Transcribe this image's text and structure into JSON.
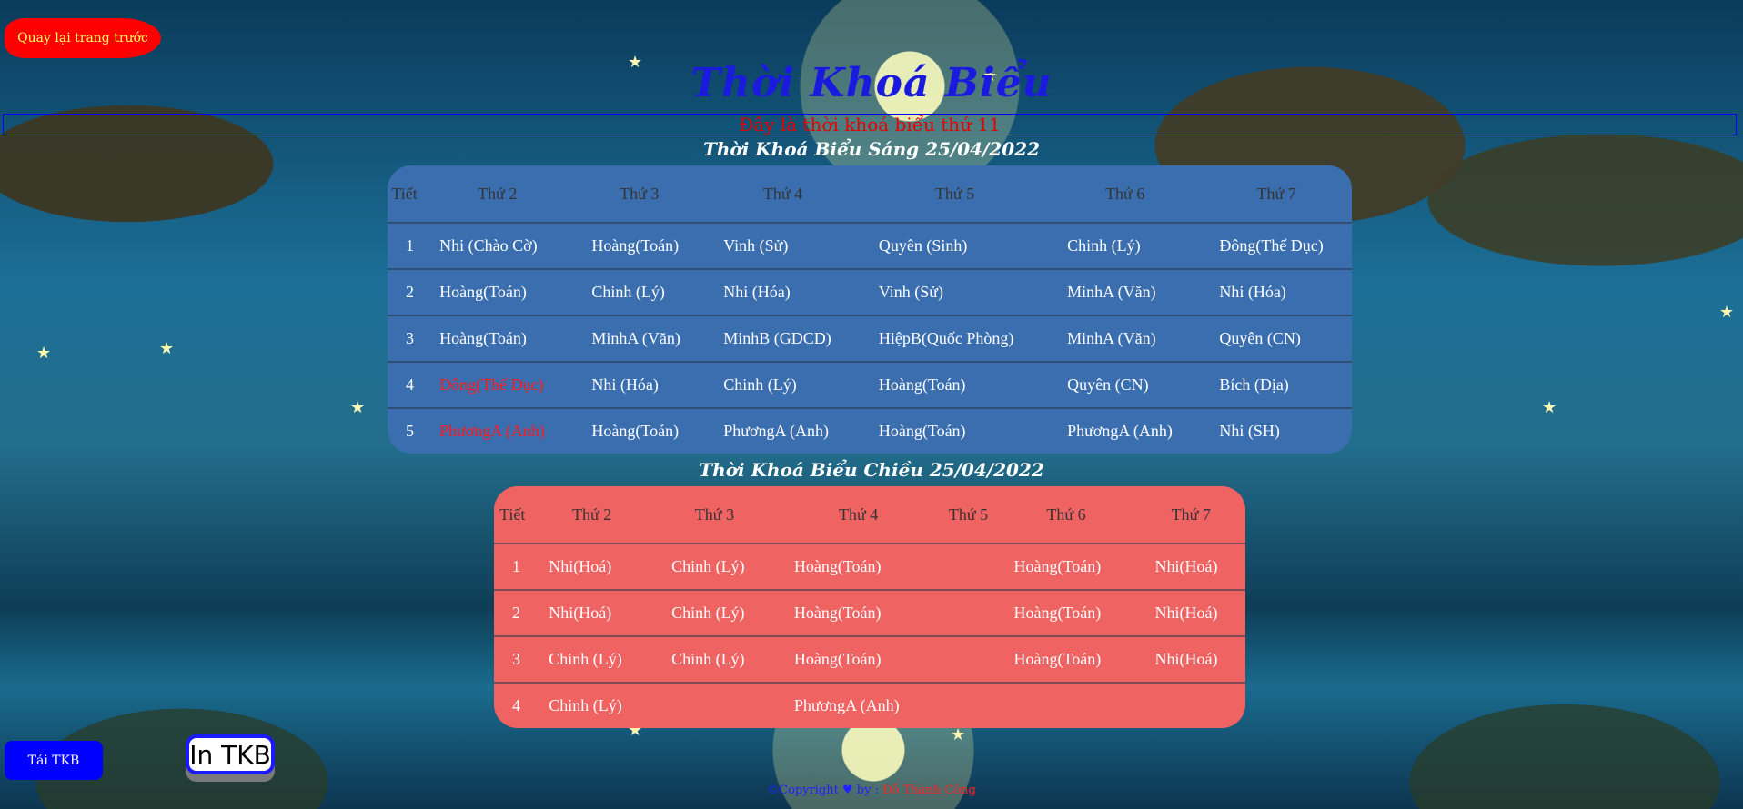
{
  "back_button": "Quay lại trang trước",
  "title": "Thời Khoá Biểu",
  "notice": "Đây là thời khoá biểu thứ 11",
  "morning": {
    "heading": "Thời Khoá Biểu Sáng 25/04/2022",
    "headers": [
      "Tiết",
      "Thứ 2",
      "Thứ 3",
      "Thứ 4",
      "Thứ 5",
      "Thứ 6",
      "Thứ 7"
    ],
    "rows": [
      [
        "1",
        "Nhi (Chào Cờ)",
        "Hoàng(Toán)",
        "Vinh (Sử)",
        "Quyên (Sinh)",
        "Chinh (Lý)",
        "Đông(Thể Dục)"
      ],
      [
        "2",
        "Hoàng(Toán)",
        "Chinh (Lý)",
        "Nhi (Hóa)",
        "Vinh (Sử)",
        "MinhA (Văn)",
        "Nhi (Hóa)"
      ],
      [
        "3",
        "Hoàng(Toán)",
        "MinhA (Văn)",
        "MinhB (GDCD)",
        "HiệpB(Quốc Phòng)",
        "MinhA (Văn)",
        "Quyên (CN)"
      ],
      [
        "4",
        "Đông(Thể Dục)",
        "Nhi (Hóa)",
        "Chinh (Lý)",
        "Hoàng(Toán)",
        "Quyên (CN)",
        "Bích (Địa)"
      ],
      [
        "5",
        "PhươngA (Anh)",
        "Hoàng(Toán)",
        "PhươngA (Anh)",
        "Hoàng(Toán)",
        "PhươngA (Anh)",
        "Nhi (SH)"
      ]
    ]
  },
  "afternoon": {
    "heading": "Thời Khoá Biểu Chiều 25/04/2022",
    "headers": [
      "Tiết",
      "Thứ 2",
      "Thứ 3",
      "Thứ 4",
      "Thứ 5",
      "Thứ 6",
      "Thứ 7"
    ],
    "rows": [
      [
        "1",
        "Nhi(Hoá)",
        "Chinh (Lý)",
        "Hoàng(Toán)",
        "",
        "Hoàng(Toán)",
        "Nhi(Hoá)"
      ],
      [
        "2",
        "Nhi(Hoá)",
        "Chinh (Lý)",
        "Hoàng(Toán)",
        "",
        "Hoàng(Toán)",
        "Nhi(Hoá)"
      ],
      [
        "3",
        "Chinh (Lý)",
        "Chinh (Lý)",
        "Hoàng(Toán)",
        "",
        "Hoàng(Toán)",
        "Nhi(Hoá)"
      ],
      [
        "4",
        "Chinh (Lý)",
        "",
        "PhươngA (Anh)",
        "",
        "",
        ""
      ]
    ]
  },
  "download_button": "Tải TKB",
  "print_button": "In TKB",
  "footer": {
    "copyright": "©Copyright ♥ by : ",
    "author": "Đỗ Thành Công"
  },
  "colors": {
    "morning_table": "#3a6eae",
    "afternoon_table": "#f06363",
    "highlight": "#ff1a1a"
  }
}
